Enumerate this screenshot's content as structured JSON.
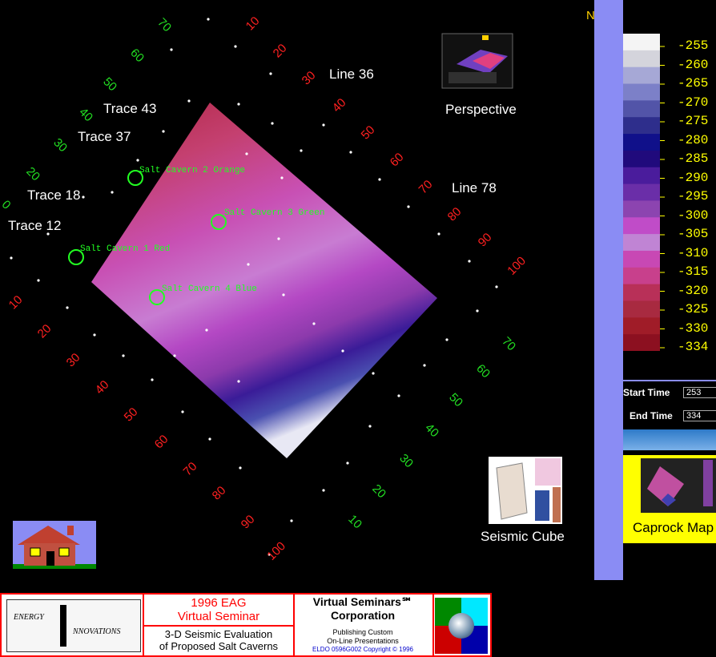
{
  "compass_label": "N",
  "map": {
    "trace_labels": [
      "Trace 43",
      "Trace 37",
      "Trace 18",
      "Trace 12"
    ],
    "line_labels": [
      "Line 36",
      "Line 78"
    ],
    "caverns": [
      "Salt Cavern 2 Orange",
      "Salt Cavern 3 Green",
      "Salt Cavern 1 Red",
      "Salt Cavern 4 Blue"
    ],
    "red_numbers": [
      "10",
      "20",
      "30",
      "40",
      "50",
      "60",
      "70",
      "80",
      "90",
      "100"
    ],
    "green_numbers": [
      "70",
      "60",
      "50",
      "40",
      "30",
      "20",
      "0"
    ],
    "red_numbers_left": [
      "10",
      "20",
      "30",
      "40",
      "50",
      "60",
      "70",
      "80",
      "90",
      "100"
    ],
    "green_numbers_right": [
      "70",
      "60",
      "50",
      "40",
      "30",
      "20",
      "10"
    ]
  },
  "thumbnails": {
    "perspective": "Perspective",
    "seismic_cube": "Seismic Cube",
    "caprock": "Caprock Map"
  },
  "legend": {
    "labels": [
      "-255",
      "-260",
      "-265",
      "-270",
      "-275",
      "-280",
      "-285",
      "-290",
      "-295",
      "-300",
      "-305",
      "-310",
      "-315",
      "-320",
      "-325",
      "-330",
      "-334"
    ],
    "colors": [
      "#f4f4f4",
      "#d4d4dc",
      "#a6a8d6",
      "#7c80c8",
      "#5254a8",
      "#2e2e8c",
      "#10108a",
      "#200a7c",
      "#4a1c9c",
      "#6a2ea8",
      "#8c44b0",
      "#c04cc8",
      "#c084d4",
      "#c848b4",
      "#c8408c",
      "#b83058",
      "#a82a40",
      "#a01c28",
      "#8c1020"
    ]
  },
  "controls": {
    "start_time_label": "Start Time",
    "start_time_value": "253",
    "end_time_label": "End Time",
    "end_time_value": "334"
  },
  "footer": {
    "logo_line1": "ENERGY",
    "logo_line2": "NNOVATIONS",
    "eag_line1": "1996 EAG",
    "eag_line2": "Virtual Seminar",
    "eval_line1": "3-D Seismic Evaluation",
    "eval_line2": "of Proposed Salt Caverns",
    "corp_line1": "Virtual Seminars℠",
    "corp_line2": "Corporation",
    "pub_line1": "Publishing Custom",
    "pub_line2": "On-Line Presentations",
    "copyright": "ELDO 0596G002 Copyright © 1996"
  }
}
